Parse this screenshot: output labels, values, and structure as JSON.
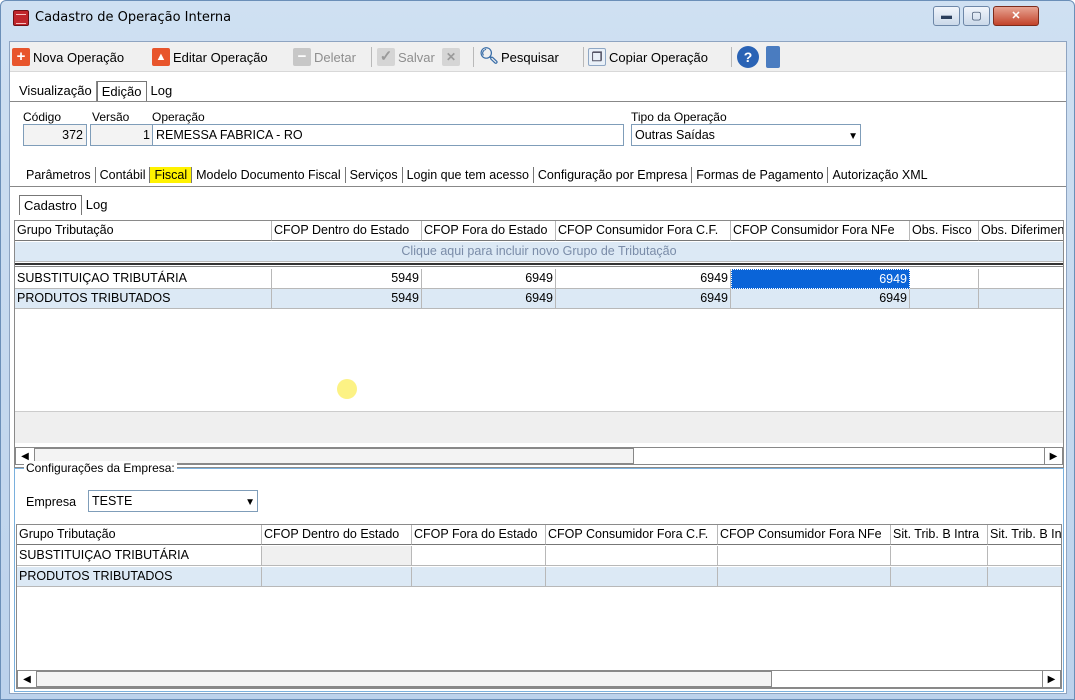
{
  "window": {
    "title": "Cadastro de Operação Interna"
  },
  "toolbar": {
    "nova": "Nova Operação",
    "editar": "Editar Operação",
    "deletar": "Deletar",
    "salvar": "Salvar",
    "pesquisar": "Pesquisar",
    "copiar": "Copiar Operação"
  },
  "main_tabs": [
    "Visualização",
    "Edição",
    "Log"
  ],
  "fields": {
    "codigo_label": "Código",
    "versao_label": "Versão",
    "operacao_label": "Operação",
    "tipo_label": "Tipo da Operação",
    "codigo": "372",
    "versao": "1",
    "operacao": "REMESSA FABRICA - RO",
    "tipo": "Outras Saídas"
  },
  "fiscal_tabs": [
    "Parâmetros",
    "Contábil",
    "Fiscal",
    "Modelo Documento Fiscal",
    "Serviços",
    "Login que tem acesso",
    "Configuração por Empresa",
    "Formas de Pagamento",
    "Autorização XML"
  ],
  "sub_tabs": [
    "Cadastro",
    "Log"
  ],
  "grid1": {
    "headers": [
      "Grupo Tributação",
      "CFOP Dentro do Estado",
      "CFOP Fora do Estado",
      "CFOP Consumidor Fora C.F.",
      "CFOP Consumidor Fora NFe",
      "Obs. Fisco",
      "Obs. Diferimen"
    ],
    "new_row": "Clique aqui para incluir novo Grupo de Tributação",
    "rows": [
      {
        "grupo": "SUBSTITUIÇAO TRIBUTÁRIA",
        "c1": "5949",
        "c2": "6949",
        "c3": "6949",
        "c4": "6949"
      },
      {
        "grupo": "PRODUTOS TRIBUTADOS",
        "c1": "5949",
        "c2": "6949",
        "c3": "6949",
        "c4": "6949"
      }
    ]
  },
  "empresa": {
    "group_label": "Configurações da Empresa:",
    "label": "Empresa",
    "value": "TESTE"
  },
  "grid2": {
    "headers": [
      "Grupo Tributação",
      "CFOP Dentro do Estado",
      "CFOP Fora do Estado",
      "CFOP Consumidor Fora C.F.",
      "CFOP Consumidor Fora NFe",
      "Sit. Trib. B Intra",
      "Sit. Trib. B In"
    ],
    "rows": [
      {
        "grupo": "SUBSTITUIÇAO TRIBUTÁRIA"
      },
      {
        "grupo": "PRODUTOS TRIBUTADOS"
      }
    ]
  },
  "colors": {
    "accent": "#0a64d8",
    "alt_row": "#dce9f5",
    "highlight": "#fff200"
  }
}
